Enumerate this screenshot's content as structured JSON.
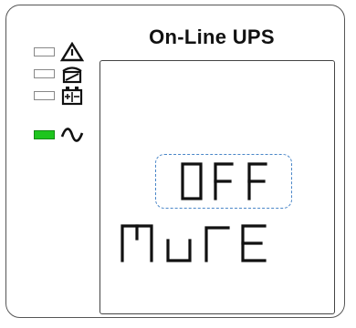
{
  "title": "On-Line UPS",
  "indicators": [
    {
      "name": "fault",
      "icon": "warning-triangle-icon",
      "active": false
    },
    {
      "name": "bypass",
      "icon": "bypass-icon",
      "active": false
    },
    {
      "name": "battery",
      "icon": "battery-icon",
      "active": false
    },
    {
      "name": "line",
      "icon": "ac-sine-icon",
      "active": true,
      "color": "#1ec51e"
    }
  ],
  "display": {
    "line1": "OFF",
    "line2": "MUTE",
    "highlight_color": "#4a86c8"
  }
}
